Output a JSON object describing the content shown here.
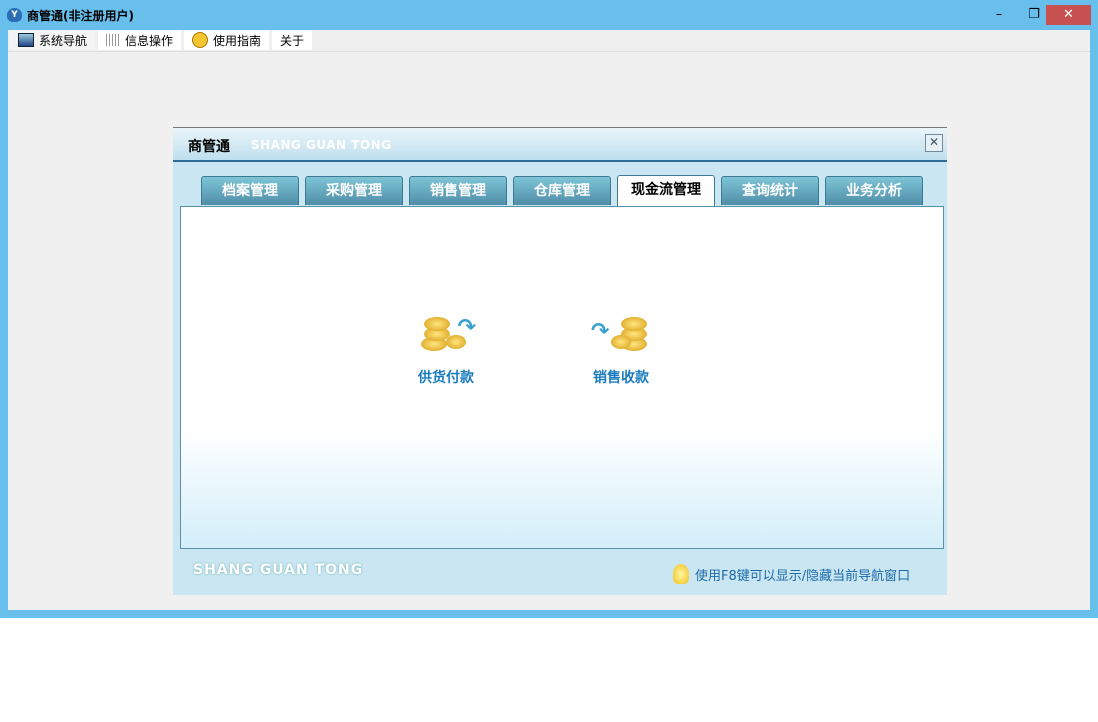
{
  "window": {
    "title": "商管通(非注册用户)",
    "minimize": "–",
    "restore": "❐",
    "close": "✕"
  },
  "menu": [
    {
      "label": "系统导航",
      "icon": "monitor-icon"
    },
    {
      "label": "信息操作",
      "icon": "grid-icon"
    },
    {
      "label": "使用指南",
      "icon": "help-icon"
    },
    {
      "label": "关于"
    }
  ],
  "dialog": {
    "title": "商管通",
    "subtitle": "SHANG GUAN TONG",
    "close": "✕",
    "tabs": [
      "档案管理",
      "采购管理",
      "销售管理",
      "仓库管理",
      "现金流管理",
      "查询统计",
      "业务分析"
    ],
    "active_tab": "现金流管理",
    "functions": [
      "供货付款",
      "销售收款"
    ],
    "footer_logo": "SHANG GUAN TONG",
    "footer_tip": "使用F8键可以显示/隐藏当前导航窗口"
  }
}
